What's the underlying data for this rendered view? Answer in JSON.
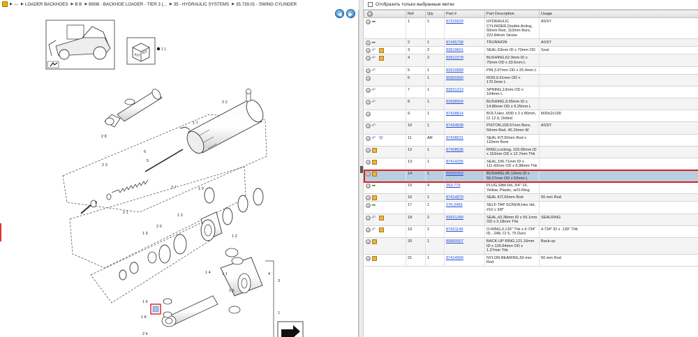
{
  "breadcrumb": [
    {
      "label": "---"
    },
    {
      "label": "LOADER BACKHOES"
    },
    {
      "label": "B B"
    },
    {
      "label": "B90B - BACKHOE LOADER - TIER 3 (..."
    },
    {
      "label": "35 - HYDRAULIC SYSTEMS"
    },
    {
      "label": "35.739.01 - SWING CYLINDER"
    }
  ],
  "nav": {
    "back_icon": "arrow-left-icon",
    "forward_icon": "arrow-right-icon"
  },
  "filter": {
    "label": "Отобразить только выбранные метки",
    "checked": false
  },
  "columns": [
    "",
    "Ref",
    "Qty",
    "Part #",
    "Part Description",
    "Usage"
  ],
  "diagram": {
    "callouts": [
      "2 8",
      "1 7",
      "2 2",
      "6",
      "5",
      "2 3",
      "2 7",
      "9",
      "2 1",
      "1 0",
      "1 9",
      "2 0",
      "1 3",
      "1 2",
      "1 1",
      "1 4",
      "1 5",
      "1 6",
      "1 8",
      "2 6",
      "4",
      "3",
      "1"
    ],
    "kit_label": "KIT",
    "kit_ref": "1 1",
    "highlight_ref": "1 4",
    "colors": {
      "highlight": "#d62020",
      "line": "#333333"
    }
  },
  "parts": [
    {
      "ref": "1",
      "qty": "1",
      "part": "87315529",
      "desc": "HYDRAULIC CYLINDER,Double Acting, 50mm Rod, 110mm Bore, 222.84mm Stroke",
      "usage": "ASSY",
      "icons": [
        "a"
      ]
    },
    {
      "ref": "2",
      "qty": "1",
      "part": "87445758",
      "desc": "TRUNNION",
      "usage": "ASSY",
      "icons": [
        "a"
      ]
    },
    {
      "ref": "3",
      "qty": "2",
      "part": "83919601",
      "desc": "SEAL,63mm ID x 70mm OD",
      "usage": "Seal",
      "icons": [
        "b",
        "c"
      ]
    },
    {
      "ref": "4",
      "qty": "2",
      "part": "83912378",
      "desc": "BUSHING,62.9mm ID x 70mm OD x 33.5mm L",
      "usage": "",
      "icons": [
        "b",
        "c"
      ]
    },
    {
      "ref": "5",
      "qty": "1",
      "part": "83910589",
      "desc": "PIN,3.97mm OD x 25.4mm L",
      "usage": "",
      "icons": [
        "b"
      ]
    },
    {
      "ref": "6",
      "qty": "1",
      "part": "85800990",
      "desc": "ROD,9.61mm OD x 170.5mm L",
      "usage": "",
      "icons": []
    },
    {
      "ref": "7",
      "qty": "1",
      "part": "83931313",
      "desc": "SPRING,13mm OD x 104mm L",
      "usage": "",
      "icons": [
        "b"
      ]
    },
    {
      "ref": "8",
      "qty": "1",
      "part": "83998909",
      "desc": "BUSHING,9.65mm ID x 14.86mm OD x 9.25mm L",
      "usage": "",
      "icons": [
        "b"
      ]
    },
    {
      "ref": "9",
      "qty": "1",
      "part": "87428814",
      "desc": "BOLT,Hex, M30 x 2 x 80mm, CI 12.9, Drilled",
      "usage": "M30x2x100",
      "icons": []
    },
    {
      "ref": "10",
      "qty": "1",
      "part": "87424838",
      "desc": "PISTON,109.57mm Bore, 50mm Rod, 45.15mm W",
      "usage": "ASSY",
      "icons": [
        "b"
      ]
    },
    {
      "ref": "11",
      "qty": "AR",
      "part": "87428631",
      "desc": "SEAL KIT,50mm Rod x 110mm Bore",
      "usage": "",
      "icons": [
        "b",
        "w"
      ]
    },
    {
      "ref": "12",
      "qty": "1",
      "part": "87408636",
      "desc": "RING,Locking, 103.65mm ID x 110mm OD x 12.7mm Thk",
      "usage": "",
      "icons": [
        "c"
      ]
    },
    {
      "ref": "13",
      "qty": "1",
      "part": "87414335",
      "desc": "SEAL,106.71mm ID x 111.43mm OD x 6.98mm Thk",
      "usage": "",
      "icons": [
        "c"
      ]
    },
    {
      "ref": "14",
      "qty": "1",
      "part": "85800303",
      "desc": "BUSHING,45.13mm ID x 55.07mm OD x 52mm L",
      "usage": "",
      "icons": [
        "c"
      ],
      "selected": true
    },
    {
      "ref": "15",
      "qty": "4",
      "part": "353-779",
      "desc": "PLUG,Slttd Hd, 3/4\"-16, Yellow, Plastic, w/O-Ring",
      "usage": "",
      "icons": [
        "a"
      ]
    },
    {
      "ref": "16",
      "qty": "1",
      "part": "87414970",
      "desc": "SEAL KIT,50mm Rod",
      "usage": "50 mm Rod",
      "icons": [
        "c"
      ]
    },
    {
      "ref": "17",
      "qty": "1",
      "part": "276-2456",
      "desc": "SELF-TAP SCREW,Hex Hd, #10 x 3/8\"",
      "usage": "",
      "icons": [
        "a"
      ]
    },
    {
      "ref": "18",
      "qty": "2",
      "part": "83931289",
      "desc": "SEAL,43.38mm ID x 55.1mm OD x 3.18mm Thk",
      "usage": "SEALRING",
      "icons": [
        "b",
        "c"
      ]
    },
    {
      "ref": "19",
      "qty": "1",
      "part": "87421149",
      "desc": "O-RING,0.139\" Thk x 4.734\" ID, -248, CI 5, 75 Duro",
      "usage": "4.734\" ID x .139\" Thk",
      "icons": [
        "b",
        "c"
      ]
    },
    {
      "ref": "20",
      "qty": "1",
      "part": "85800007",
      "desc": "BACK-UP RING,121.16mm ID x 126.64mm OD x 1.27mm Thk",
      "usage": "Back-up",
      "icons": [
        "c"
      ]
    },
    {
      "ref": "21",
      "qty": "1",
      "part": "87414999",
      "desc": "NYLON BEARING,50 mm Rod",
      "usage": "50 mm Rod",
      "icons": [
        "c"
      ]
    }
  ]
}
